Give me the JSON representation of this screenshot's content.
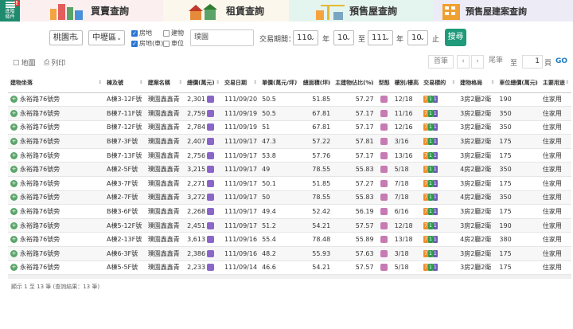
{
  "tabs": {
    "advanced_label_1": "進階",
    "advanced_label_2": "條件",
    "badge": "!",
    "items": [
      {
        "label": "買賣查詢"
      },
      {
        "label": "租賃查詢"
      },
      {
        "label": "預售屋查詢"
      },
      {
        "label": "預售屋建案查詢"
      }
    ]
  },
  "filter": {
    "city": "桃園市",
    "district": "中壢區",
    "chk_land": "房地",
    "chk_land_car": "房地(車)",
    "chk_building": "建物",
    "chk_parking": "車位",
    "search_placeholder": "璞園",
    "period_label": "交易期間：",
    "start_year": "110",
    "year_unit": "年",
    "start_month": "10",
    "to_label": "至",
    "end_year": "111",
    "end_month": "10",
    "end_label": "止",
    "query_button": "搜尋"
  },
  "tools": {
    "map": "地圖",
    "print": "列印",
    "first": "首筆",
    "prev": "‹",
    "next": "›",
    "last": "尾筆",
    "to": "至",
    "page": "1",
    "page_unit": "頁",
    "go": "GO"
  },
  "table": {
    "headers": [
      "建物坐落",
      "棟及號",
      "建案名稱",
      "總價(萬元)",
      "交易日期",
      "單價(萬元/坪)",
      "總面積(坪)",
      "主建物佔比(%)",
      "型態",
      "樓別/樓高",
      "交易標的",
      "建物格局",
      "車位總價(萬元)",
      "主要用途"
    ],
    "rows": [
      {
        "addr": "永裕路76號旁",
        "unit": "A棟3-12F號",
        "name": "璞園鑫鑫青",
        "price": "2,301",
        "date": "111/09/20",
        "unit_price": "50.5",
        "area": "51.85",
        "ratio": "57.27",
        "floor": "12/18",
        "layout": "3房2廳2衛",
        "park": "190",
        "use": "住家用"
      },
      {
        "addr": "永裕路76號旁",
        "unit": "B棟7-11F號",
        "name": "璞園鑫鑫青",
        "price": "2,759",
        "date": "111/09/19",
        "unit_price": "50.5",
        "area": "67.81",
        "ratio": "57.17",
        "floor": "11/16",
        "layout": "3房2廳2衛",
        "park": "350",
        "use": "住家用"
      },
      {
        "addr": "永裕路76號旁",
        "unit": "B棟7-12F號",
        "name": "璞園鑫鑫青",
        "price": "2,784",
        "date": "111/09/19",
        "unit_price": "51",
        "area": "67.81",
        "ratio": "57.17",
        "floor": "12/16",
        "layout": "3房2廳2衛",
        "park": "350",
        "use": "住家用"
      },
      {
        "addr": "永裕路76號旁",
        "unit": "B棟7-3F號",
        "name": "璞園鑫鑫青",
        "price": "2,407",
        "date": "111/09/17",
        "unit_price": "47.3",
        "area": "57.22",
        "ratio": "57.81",
        "floor": "3/16",
        "layout": "3房2廳2衛",
        "park": "175",
        "use": "住家用"
      },
      {
        "addr": "永裕路76號旁",
        "unit": "B棟7-13F號",
        "name": "璞園鑫鑫青",
        "price": "2,756",
        "date": "111/09/17",
        "unit_price": "53.8",
        "area": "57.76",
        "ratio": "57.17",
        "floor": "13/16",
        "layout": "3房2廳2衛",
        "park": "175",
        "use": "住家用"
      },
      {
        "addr": "永裕路76號旁",
        "unit": "A棟2-5F號",
        "name": "璞園鑫鑫青",
        "price": "3,215",
        "date": "111/09/17",
        "unit_price": "49",
        "area": "78.55",
        "ratio": "55.83",
        "floor": "5/18",
        "layout": "4房2廳2衛",
        "park": "350",
        "use": "住家用"
      },
      {
        "addr": "永裕路76號旁",
        "unit": "A棟3-7F號",
        "name": "璞園鑫鑫青",
        "price": "2,271",
        "date": "111/09/17",
        "unit_price": "50.1",
        "area": "51.85",
        "ratio": "57.27",
        "floor": "7/18",
        "layout": "3房2廳2衛",
        "park": "175",
        "use": "住家用"
      },
      {
        "addr": "永裕路76號旁",
        "unit": "A棟2-7F號",
        "name": "璞園鑫鑫青",
        "price": "3,272",
        "date": "111/09/17",
        "unit_price": "50",
        "area": "78.55",
        "ratio": "55.83",
        "floor": "7/18",
        "layout": "4房2廳2衛",
        "park": "350",
        "use": "住家用"
      },
      {
        "addr": "永裕路76號旁",
        "unit": "B棟3-6F號",
        "name": "璞園鑫鑫青",
        "price": "2,268",
        "date": "111/09/17",
        "unit_price": "49.4",
        "area": "52.42",
        "ratio": "56.19",
        "floor": "6/16",
        "layout": "3房2廳2衛",
        "park": "175",
        "use": "住家用"
      },
      {
        "addr": "永裕路76號旁",
        "unit": "A棟5-12F號",
        "name": "璞園鑫鑫青",
        "price": "2,451",
        "date": "111/09/17",
        "unit_price": "51.2",
        "area": "54.21",
        "ratio": "57.57",
        "floor": "12/18",
        "layout": "3房2廳2衛",
        "park": "190",
        "use": "住家用"
      },
      {
        "addr": "永裕路76號旁",
        "unit": "A棟2-13F號",
        "name": "璞園鑫鑫青",
        "price": "3,613",
        "date": "111/09/16",
        "unit_price": "55.4",
        "area": "78.48",
        "ratio": "55.89",
        "floor": "13/18",
        "layout": "4房2廳2衛",
        "park": "380",
        "use": "住家用"
      },
      {
        "addr": "永裕路76號旁",
        "unit": "A棟6-3F號",
        "name": "璞園鑫鑫青",
        "price": "2,386",
        "date": "111/09/16",
        "unit_price": "48.2",
        "area": "55.93",
        "ratio": "57.63",
        "floor": "3/18",
        "layout": "3房2廳2衛",
        "park": "175",
        "use": "住家用"
      },
      {
        "addr": "永裕路76號旁",
        "unit": "A棟5-5F號",
        "name": "璞園鑫鑫青",
        "price": "2,233",
        "date": "111/09/14",
        "unit_price": "46.6",
        "area": "54.21",
        "ratio": "57.57",
        "floor": "5/18",
        "layout": "3房2廳2衛",
        "park": "175",
        "use": "住家用"
      }
    ],
    "tag_labels": [
      "7",
      "1",
      "1"
    ]
  },
  "footer": "顯示 1 至 13 筆 (查詢結果：13 筆)",
  "colors": {
    "accent": "#1f9a7a",
    "address": "#3a7d4d"
  }
}
